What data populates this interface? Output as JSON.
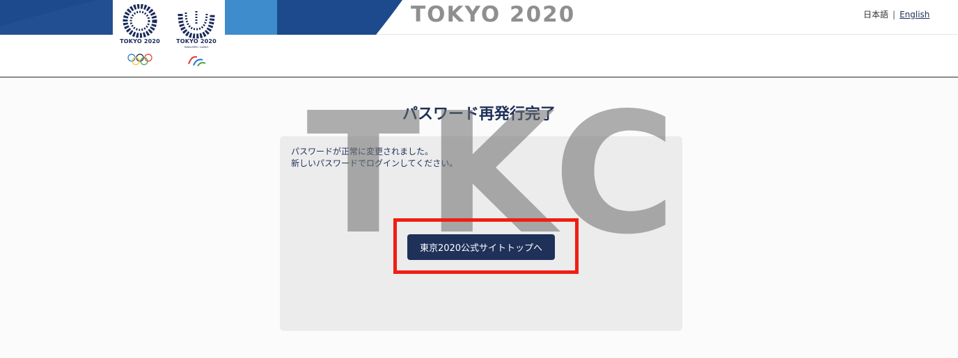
{
  "header": {
    "brand_title": "TOKYO 2020",
    "olympic_caption": "TOKYO 2020",
    "paralympic_caption": "TOKYO 2020",
    "paralympic_subcaption": "PARALYMPIC GAMES",
    "language": {
      "ja_label": "日本語",
      "separator": "|",
      "en_label": "English"
    }
  },
  "watermark": "TKC",
  "main": {
    "title": "パスワード再発行完了",
    "message_lines": [
      "パスワードが正常に変更されました。",
      "新しいパスワードでログインしてください。"
    ],
    "top_button_label": "東京2020公式サイトトップへ"
  },
  "colors": {
    "navy": "#1f3158",
    "stripe_dark": "#1c4a8c",
    "stripe_light": "#3f8ccc",
    "highlight": "#f01e12",
    "panel": "#ececec"
  }
}
